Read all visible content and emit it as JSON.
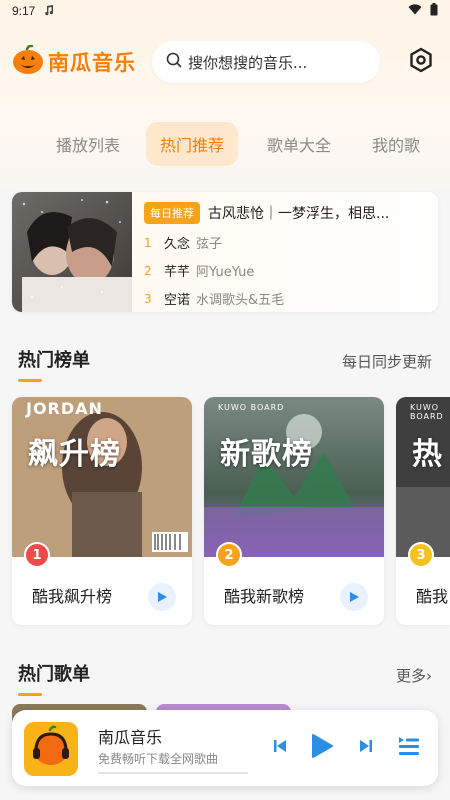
{
  "status_bar": {
    "time": "9:17",
    "note_icon": "music-note-icon"
  },
  "app": {
    "name": "南瓜音乐",
    "brand_color": "#f47f0d",
    "accent_color": "#f7a21b"
  },
  "search": {
    "placeholder": "搜你想搜的音乐..."
  },
  "tabs": [
    {
      "label": "播放列表",
      "active": false
    },
    {
      "label": "热门推荐",
      "active": true
    },
    {
      "label": "歌单大全",
      "active": false
    },
    {
      "label": "我的歌",
      "active": false
    }
  ],
  "daily": {
    "badge": "每日推荐",
    "title": "古风悲怆｜一梦浮生，相思...",
    "songs": [
      {
        "rank": "1",
        "name": "久念",
        "artist": "弦子"
      },
      {
        "rank": "2",
        "name": "芊芊",
        "artist": "阿YueYue"
      },
      {
        "rank": "3",
        "name": "空诺",
        "artist": "水调歌头&五毛"
      }
    ]
  },
  "hot_charts": {
    "title": "热门榜单",
    "subtitle": "每日同步更新",
    "items": [
      {
        "rank": "1",
        "cover_title": "飙升榜",
        "cover_brand": "JORDAN",
        "name": "酷我飙升榜",
        "badge_color": "#f04a4a"
      },
      {
        "rank": "2",
        "cover_title": "新歌榜",
        "cover_brand": "KUWO BOARD",
        "name": "酷我新歌榜",
        "badge_color": "#f7a21b"
      },
      {
        "rank": "3",
        "cover_title": "热",
        "cover_brand": "KUWO BOARD",
        "name": "酷我",
        "badge_color": "#f6c11c"
      }
    ]
  },
  "hot_playlists": {
    "title": "热门歌单",
    "more": "更多›"
  },
  "player": {
    "title": "南瓜音乐",
    "subtitle": "免费畅听下载全网歌曲",
    "progress": 0
  }
}
